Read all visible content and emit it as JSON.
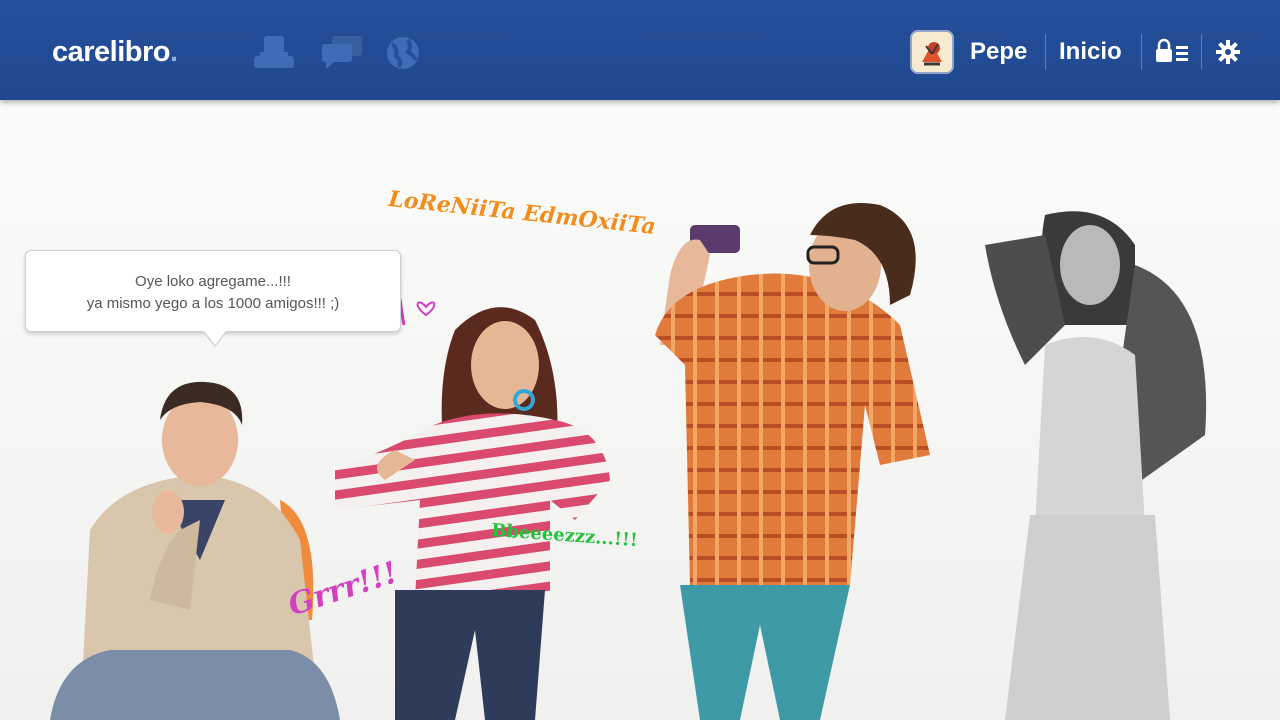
{
  "app": {
    "logo_text": "carelibro",
    "logo_dot": "."
  },
  "nav": {
    "icons": [
      "friends-icon",
      "chat-icon",
      "globe-icon"
    ],
    "user_name": "Pepe",
    "home_label": "Inicio"
  },
  "speech": {
    "line1": "Oye loko agregame...!!!",
    "line2": "ya mismo yego a los 1000 amigos!!! ;)"
  },
  "tags": {
    "loreniita": "LoReNiiTa EdmOxiiTa",
    "grrr": "Grrr!!!",
    "green": "Bbeeeezzz...!!!"
  },
  "colors": {
    "topbar": "#214b93",
    "tag_orange": "#f28c1c",
    "tag_pink": "#d23fc2",
    "tag_green": "#22c23a"
  }
}
